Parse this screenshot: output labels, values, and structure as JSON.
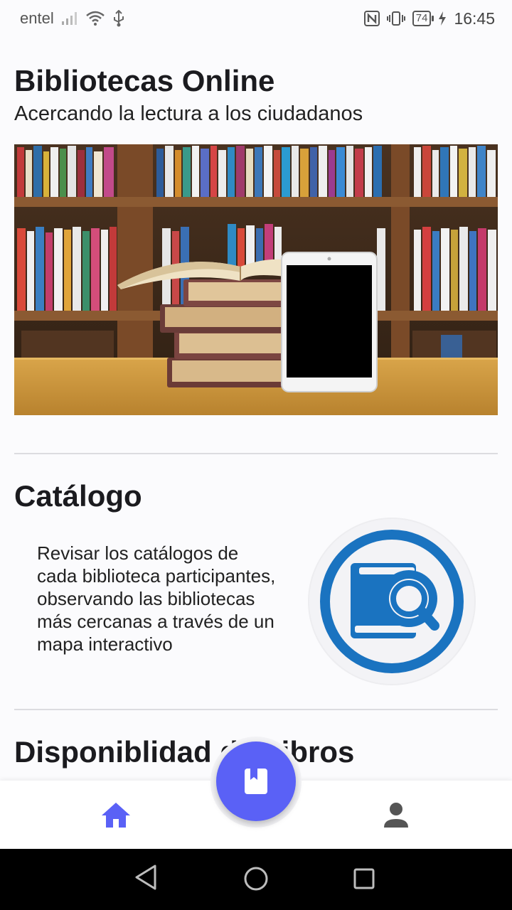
{
  "status_bar": {
    "carrier": "entel",
    "battery": "74",
    "time": "16:45",
    "icons": [
      "signal-icon",
      "wifi-icon",
      "usb-icon",
      "nfc-icon",
      "vibrate-icon",
      "battery-icon",
      "charging-icon"
    ]
  },
  "header": {
    "title": "Bibliotecas Online",
    "subtitle": "Acercando la lectura a los ciudadanos"
  },
  "catalog": {
    "title": "Catálogo",
    "description": "Revisar los catálogos de cada biblioteca participantes, observando las bibliotecas más cercanas a través de un mapa interactivo",
    "icon": "book-search-icon",
    "badge_color": "#1a73c0"
  },
  "availability": {
    "title": "Disponiblidad de Libros"
  },
  "bottom_nav": {
    "items": [
      {
        "icon": "home-icon",
        "active": true
      },
      {
        "icon": "book-icon",
        "type": "fab"
      },
      {
        "icon": "person-icon",
        "active": false
      }
    ],
    "accent": "#5a61f6",
    "inactive": "#555555"
  },
  "system_nav": {
    "buttons": [
      "back-icon",
      "home-circle-icon",
      "recents-icon"
    ]
  }
}
